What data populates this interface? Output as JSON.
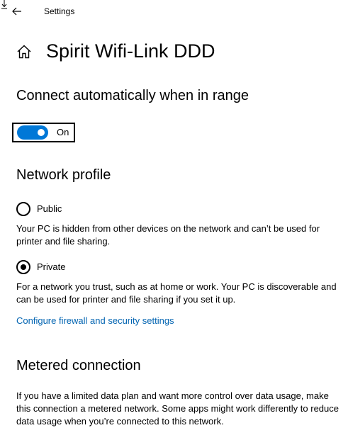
{
  "titlebar": {
    "title": "Settings",
    "back_icon": "arrow-left-icon"
  },
  "header": {
    "home_icon": "home-icon",
    "title": "Spirit Wifi-Link DDD"
  },
  "connect_auto": {
    "heading": "Connect automatically when in range",
    "toggle_state": "On",
    "toggle_on": true,
    "accent_color": "#0078d7"
  },
  "network_profile": {
    "heading": "Network profile",
    "options": [
      {
        "label": "Public",
        "selected": false,
        "description": "Your PC is hidden from other devices on the network and can’t be used for printer and file sharing."
      },
      {
        "label": "Private",
        "selected": true,
        "description": "For a network you trust, such as at home or work. Your PC is discoverable and can be used for printer and file sharing if you set it up."
      }
    ],
    "link": "Configure firewall and security settings",
    "link_color": "#0063b1"
  },
  "metered": {
    "heading": "Metered connection",
    "description": "If you have a limited data plan and want more control over data usage, make this connection a metered network. Some apps might work differently to reduce data usage when you’re connected to this network."
  }
}
